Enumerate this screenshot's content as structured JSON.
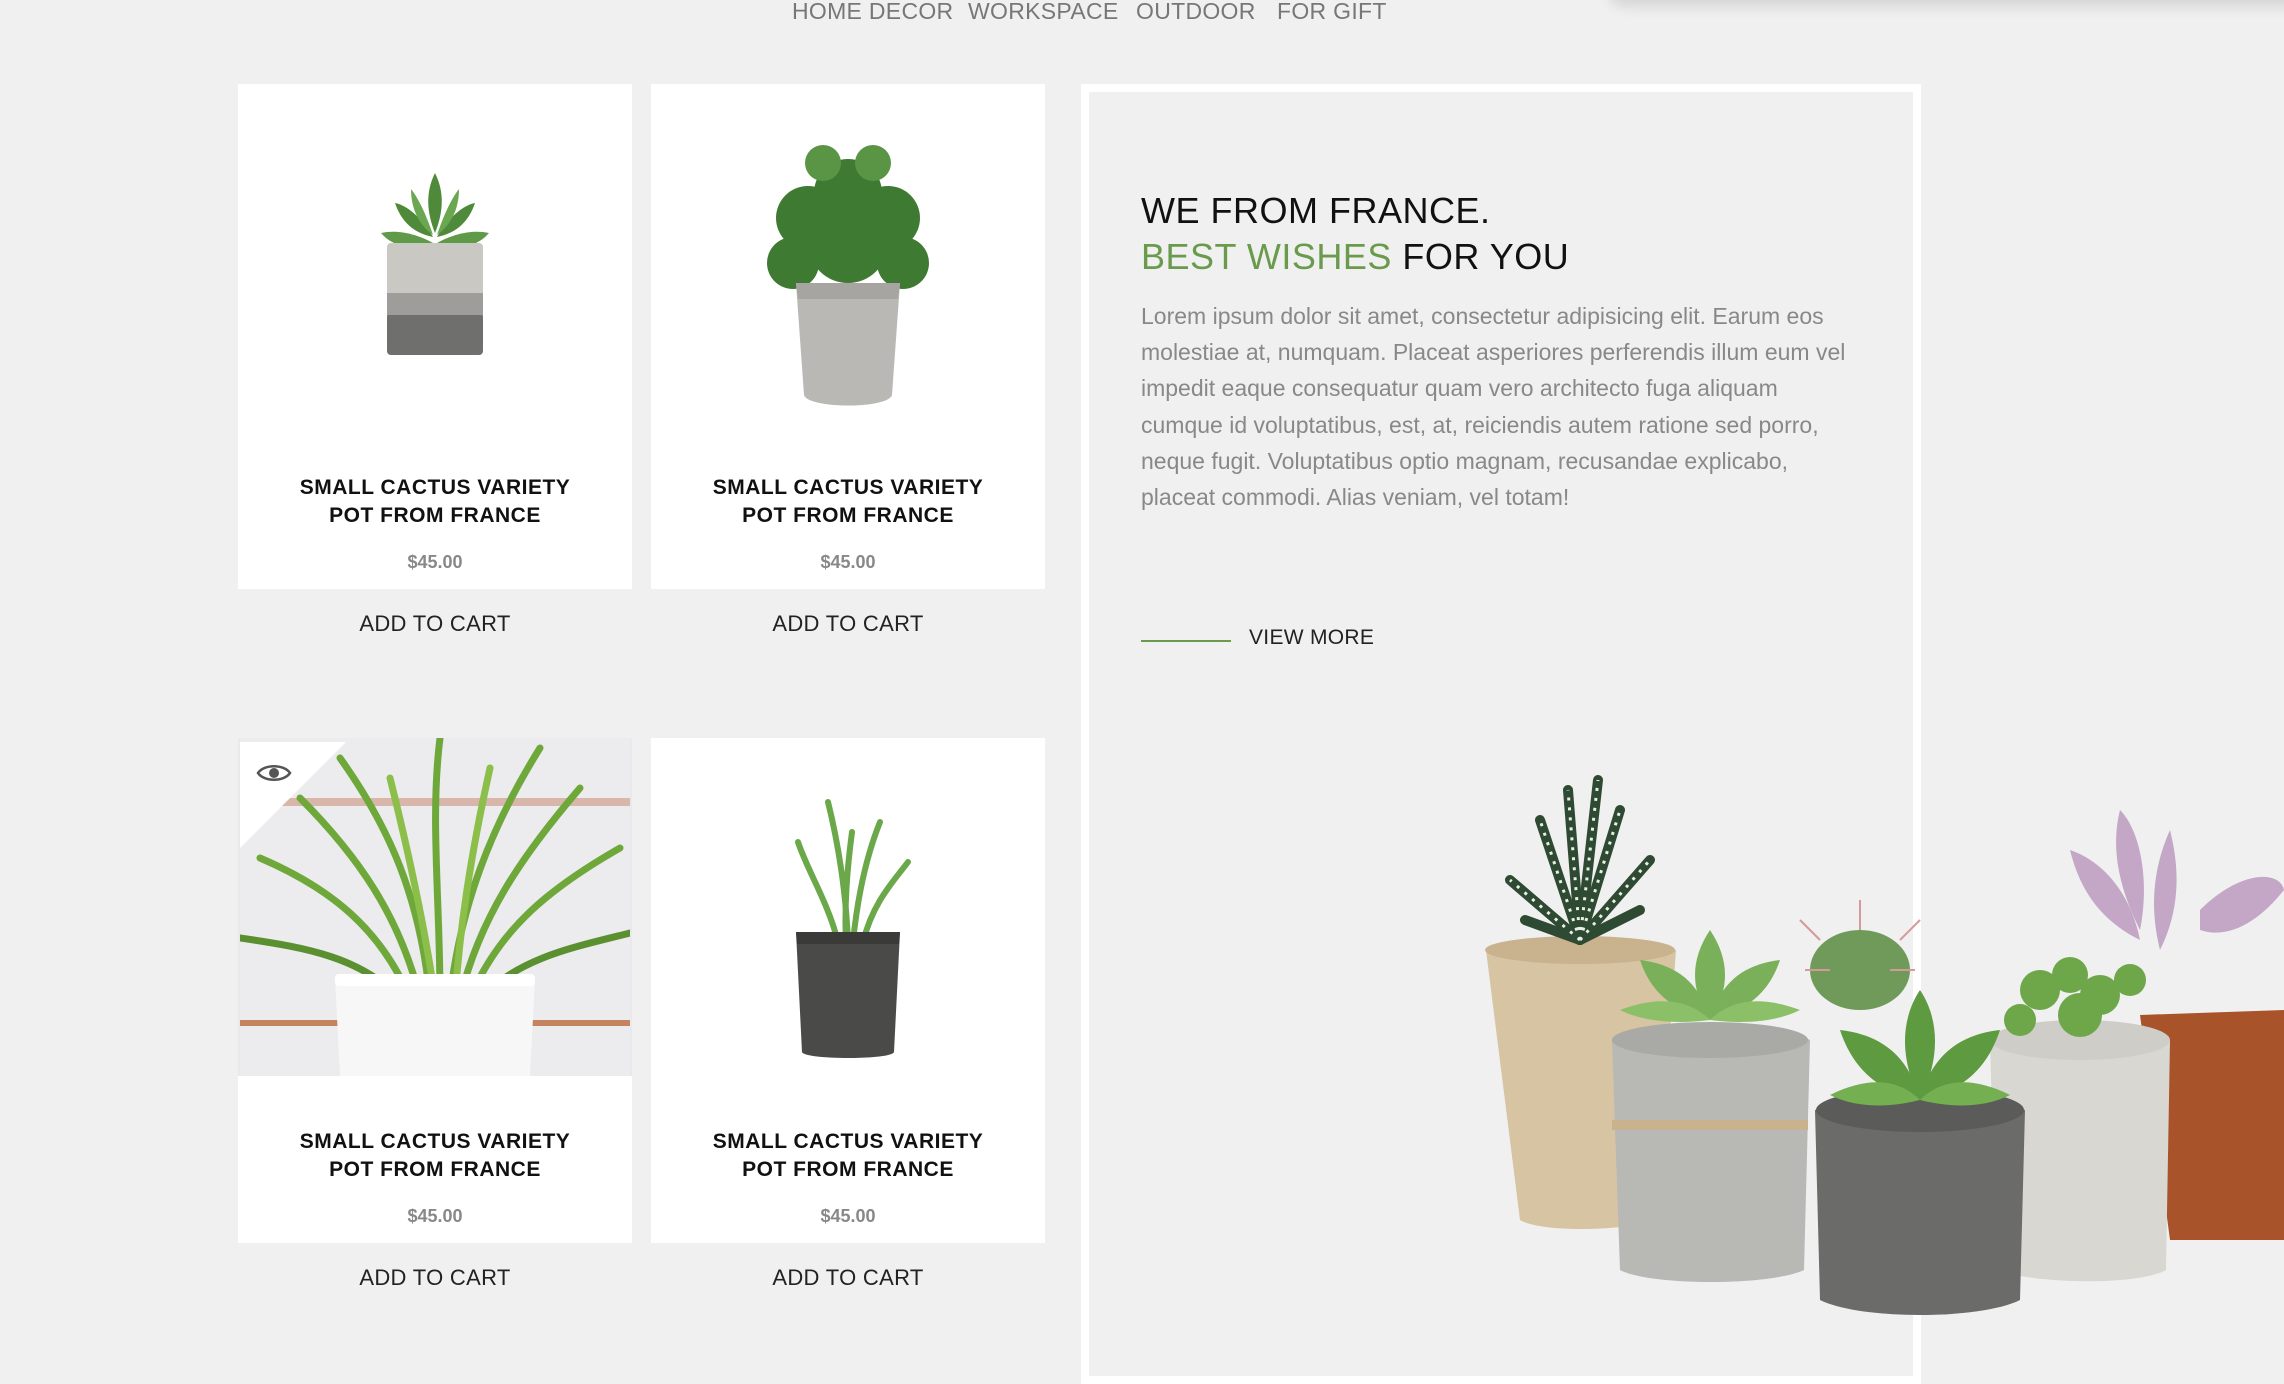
{
  "nav": {
    "items": [
      "HOME DECOR",
      "WORKSPACE",
      "OUTDOOR",
      "FOR GIFT"
    ]
  },
  "products": [
    {
      "name_line1": "SMALL CACTUS VARIETY",
      "name_line2": "POT FROM FRANCE",
      "price": "$45.00",
      "cta": "ADD TO CART"
    },
    {
      "name_line1": "SMALL CACTUS VARIETY",
      "name_line2": "POT FROM FRANCE",
      "price": "$45.00",
      "cta": "ADD TO CART"
    },
    {
      "name_line1": "SMALL CACTUS VARIETY",
      "name_line2": "POT FROM FRANCE",
      "price": "$45.00",
      "cta": "ADD TO CART"
    },
    {
      "name_line1": "SMALL CACTUS VARIETY",
      "name_line2": "POT FROM FRANCE",
      "price": "$45.00",
      "cta": "ADD TO CART"
    }
  ],
  "feature": {
    "heading_line1": "WE FROM FRANCE.",
    "heading_green": "BEST WISHES",
    "heading_rest": " FOR YOU",
    "body": "Lorem ipsum dolor sit amet, consectetur adipisicing elit. Earum eos molestiae at, numquam. Placeat asperiores perferendis illum eum vel impedit eaque consequatur quam vero architecto fuga aliquam cumque id voluptatibus, est, at, reiciendis autem ratione sed porro, neque fugit. Voluptatibus optio magnam, recusandae explicabo, placeat commodi. Alias veniam, vel totam!",
    "view_more": "VIEW MORE"
  },
  "icons": {
    "quick_view": "eye-icon"
  },
  "colors": {
    "accent_green": "#6a9a4c",
    "background": "#f0f0f0",
    "text_muted": "#888888"
  }
}
